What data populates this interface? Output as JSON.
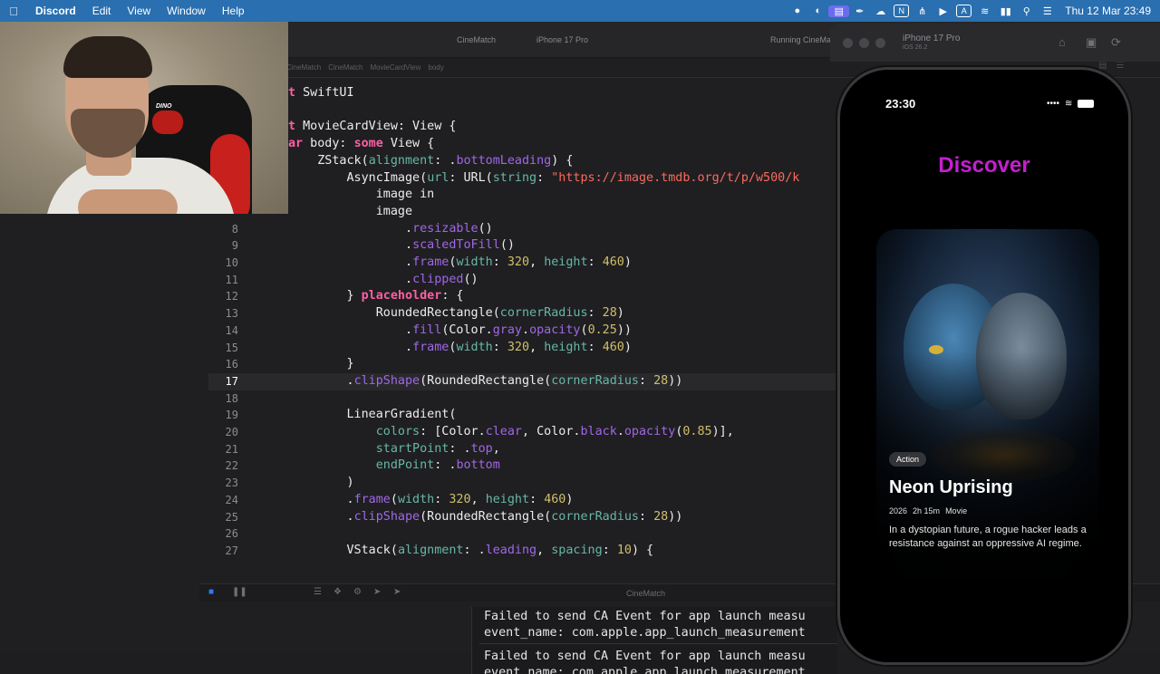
{
  "menubar": {
    "apple_icon": "apple-logo-icon",
    "app": "Discord",
    "items": [
      "Edit",
      "View",
      "Window",
      "Help"
    ],
    "clock": "Thu 12 Mar  23:49"
  },
  "xcode": {
    "scheme": "CineMatch",
    "destination": "iPhone 17 Pro",
    "status": "Running CineMa",
    "breadcrumbs": [
      "CineMatch",
      "CineMatch",
      "MovieCardView",
      "body"
    ],
    "debug_target": "CineMatch"
  },
  "editor": {
    "current_line": "17",
    "header_lines": [
      "t SwiftUI",
      "",
      "t MovieCardView: View {",
      "ar body: some View {",
      "    ZStack(alignment: .bottomLeading) {",
      "        AsyncImage(url: URL(string: \"https://image.tmdb.org/t/p/w500/k",
      "            image in",
      "            image"
    ],
    "lines": [
      {
        "n": "8",
        "t": "                .resizable()"
      },
      {
        "n": "9",
        "t": "                .scaledToFill()"
      },
      {
        "n": "10",
        "t": "                .frame(width: 320, height: 460)"
      },
      {
        "n": "11",
        "t": "                .clipped()"
      },
      {
        "n": "12",
        "t": "        } placeholder: {"
      },
      {
        "n": "13",
        "t": "            RoundedRectangle(cornerRadius: 28)"
      },
      {
        "n": "14",
        "t": "                .fill(Color.gray.opacity(0.25))"
      },
      {
        "n": "15",
        "t": "                .frame(width: 320, height: 460)"
      },
      {
        "n": "16",
        "t": "        }"
      },
      {
        "n": "17",
        "t": "        .clipShape(RoundedRectangle(cornerRadius: 28))"
      },
      {
        "n": "18",
        "t": ""
      },
      {
        "n": "19",
        "t": "        LinearGradient("
      },
      {
        "n": "20",
        "t": "            colors: [Color.clear, Color.black.opacity(0.85)],"
      },
      {
        "n": "21",
        "t": "            startPoint: .top,"
      },
      {
        "n": "22",
        "t": "            endPoint: .bottom"
      },
      {
        "n": "23",
        "t": "        )"
      },
      {
        "n": "24",
        "t": "        .frame(width: 320, height: 460)"
      },
      {
        "n": "25",
        "t": "        .clipShape(RoundedRectangle(cornerRadius: 28))"
      },
      {
        "n": "26",
        "t": ""
      },
      {
        "n": "27",
        "t": "        VStack(alignment: .leading, spacing: 10) {"
      }
    ]
  },
  "console": {
    "lines": [
      "Failed to send CA Event for app launch measu",
      "event_name: com.apple.app_launch_measurement",
      "Failed to send CA Event for app launch measu",
      "event_name: com.apple.app_launch_measurement"
    ]
  },
  "webcam": {
    "chair_badge": "DINO"
  },
  "simulator": {
    "device": "iPhone 17 Pro",
    "os": "iOS 26.2",
    "icons": [
      "home-icon",
      "screenshot-icon",
      "rotate-icon"
    ]
  },
  "app": {
    "status_time": "23:30",
    "screen_title": "Discover",
    "title_color": "#c51fd1",
    "movie": {
      "genre": "Action",
      "title": "Neon Uprising",
      "year": "2026",
      "runtime": "2h 15m",
      "type": "Movie",
      "description": "In a dystopian future, a rogue hacker leads a resistance against an oppressive AI regime."
    }
  }
}
